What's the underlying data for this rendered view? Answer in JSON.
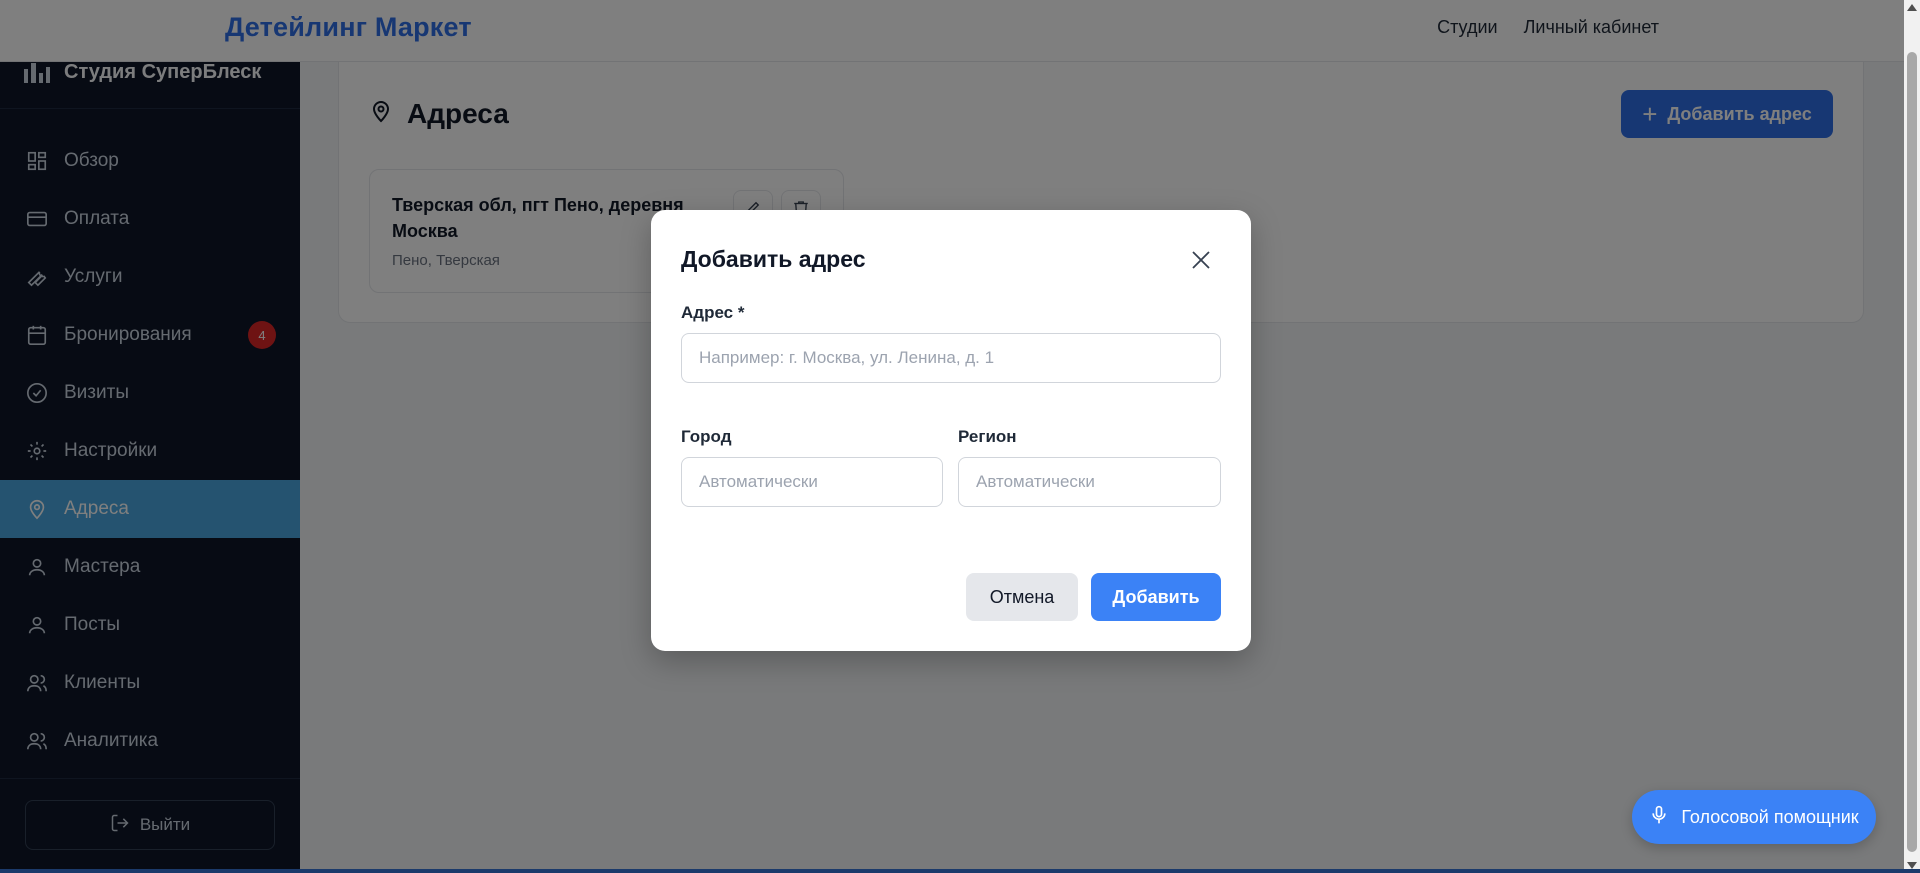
{
  "header": {
    "brand": "Детейлинг Маркет",
    "nav": [
      "Студии",
      "Личный кабинет"
    ]
  },
  "sidebar": {
    "studio_name": "Студия СуперБлеск",
    "items": [
      {
        "label": "Обзор",
        "icon": "grid-icon"
      },
      {
        "label": "Оплата",
        "icon": "credit-card-icon"
      },
      {
        "label": "Услуги",
        "icon": "wrench-icon"
      },
      {
        "label": "Бронирования",
        "icon": "calendar-icon",
        "badge": "4"
      },
      {
        "label": "Визиты",
        "icon": "check-circle-icon"
      },
      {
        "label": "Настройки",
        "icon": "gear-icon"
      },
      {
        "label": "Адреса",
        "icon": "map-pin-icon",
        "active": true
      },
      {
        "label": "Мастера",
        "icon": "user-icon"
      },
      {
        "label": "Посты",
        "icon": "user-icon"
      },
      {
        "label": "Клиенты",
        "icon": "users-icon"
      },
      {
        "label": "Аналитика",
        "icon": "users-icon"
      }
    ],
    "logout_label": "Выйти"
  },
  "page": {
    "title": "Адреса",
    "add_button": "Добавить адрес",
    "addresses": [
      {
        "title": "Тверская обл, пгт Пено, деревня Москва",
        "subtitle": "Пено, Тверская"
      }
    ]
  },
  "modal": {
    "title": "Добавить адрес",
    "address_label": "Адрес *",
    "address_placeholder": "Например: г. Москва, ул. Ленина, д. 1",
    "address_value": "",
    "city_label": "Город",
    "city_placeholder": "Автоматически",
    "region_label": "Регион",
    "region_placeholder": "Автоматически",
    "cancel_label": "Отмена",
    "submit_label": "Добавить"
  },
  "voice_assistant": {
    "label": "Голосовой помощник"
  },
  "colors": {
    "brand": "#2f6fe6",
    "sidebar_bg": "#0f1729",
    "active_item": "#4aa7e0",
    "primary_button": "#3b82f6",
    "badge": "#dc2626"
  }
}
